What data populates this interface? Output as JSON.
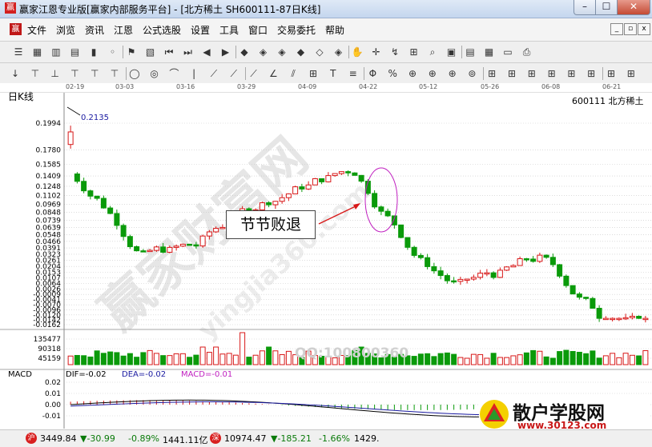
{
  "window": {
    "title": "赢家江恩专业版[赢家内部服务平台] - [北方稀土  SH600111-87日K线]",
    "logo_text": "赢",
    "min": "–",
    "max": "☐",
    "close": "✕"
  },
  "menu": {
    "logo_text": "赢",
    "items": [
      "文件",
      "浏览",
      "资讯",
      "江恩",
      "公式选股",
      "设置",
      "工具",
      "窗口",
      "交易委托",
      "帮助"
    ],
    "mdi_min": "_",
    "mdi_restore": "▫",
    "mdi_close": "x"
  },
  "toolbar1": {
    "icons": [
      "list-icon",
      "grid-icon",
      "bars-icon",
      "bar-chart-icon",
      "candle-icon",
      "cursor-icon",
      "flag-icon",
      "indicator-icon",
      "first-icon",
      "prev-icon",
      "back-icon",
      "forward-icon",
      "diamond-up-icon",
      "diamond-left-icon",
      "diamond-right-icon",
      "diamond-down-icon",
      "diamond-cross-icon",
      "diamond-all-icon",
      "hand-icon",
      "crosshair-icon",
      "zigzag-icon",
      "gift-icon",
      "search-icon",
      "calendar-icon",
      "card-icon",
      "save-icon",
      "car-icon",
      "printer-icon"
    ]
  },
  "toolbar2": {
    "icons": [
      "down-arrow-icon",
      "candle-tool-icon",
      "bars-tool-icon",
      "tick-tool-icon",
      "tick2-tool-icon",
      "tick3-tool-icon",
      "ellipse-tool-icon",
      "circle-tool-icon",
      "arc-tool-icon",
      "vline-tool-icon",
      "fan-tool-icon",
      "fan2-tool-icon",
      "speedline-tool-icon",
      "angle-tool-icon",
      "channel-tool-icon",
      "gann-tool-icon",
      "text-tool-icon",
      "lines-tool-icon",
      "fib-tool-icon",
      "percent-tool-icon",
      "gann-box-icon",
      "gann-box2-icon",
      "gann-box3-icon",
      "cycle-tool-icon",
      "gann-sq-icon",
      "gann-sq2-icon",
      "gann-sq3-icon",
      "gann-sq4-icon",
      "gann-sq5-icon",
      "gann-sq6-icon",
      "gann-sq7-icon",
      "gann-sq8-icon"
    ]
  },
  "chart": {
    "period_label": "日K线",
    "stock_label": "600111 北方稀土",
    "dates": [
      "02-19",
      "03-03",
      "03-16",
      "03-29",
      "04-09",
      "04-22",
      "05-12",
      "05-26",
      "06-08",
      "06-21"
    ],
    "high_mark": "0.2135",
    "callout": "节节败退",
    "watermark_qq": "QQ:100800360",
    "watermark_diag": "赢家财富网",
    "watermark_url": "yingjia360.com"
  },
  "chart_data": {
    "type": "candlestick",
    "price_ticks": [
      "0.1994",
      "0.1780",
      "0.1585",
      "0.1409",
      "0.1248",
      "0.1102",
      "0.0969",
      "0.0848",
      "0.0739",
      "0.0639",
      "0.0548",
      "0.0466",
      "0.0391",
      "0.0323",
      "0.0261",
      "0.0204",
      "0.0153",
      "0.0107",
      "0.0064",
      "0.0026",
      "-0.0009",
      "-0.0041",
      "-0.0070",
      "-0.0096",
      "-0.0120",
      "-0.0142",
      "-0.0162"
    ],
    "volume_ticks": [
      "135477",
      "90318",
      "45159"
    ],
    "macd_ticks": [
      "0.02",
      "0.01",
      "0.00",
      "-0.01"
    ],
    "macd_labels": {
      "name": "MACD",
      "dif": "DIF=-0.02",
      "dea": "DEA=-0.02",
      "macd": "MACD=-0.01"
    },
    "colors": {
      "up": "#d81818",
      "down": "#0a9a0a",
      "dif": "#000000",
      "dea": "#1a1aa0",
      "macd": "#c020c0"
    }
  },
  "status": {
    "sh_icon": "沪",
    "sh_index": "3449.84",
    "sh_change": "▼-30.99",
    "sh_pct": "-0.89%",
    "sh_amount": "1441.11亿",
    "sz_icon": "深",
    "sz_index": "10974.47",
    "sz_change": "▼-185.21",
    "sz_pct": "-1.66%",
    "sz_amount": "1429."
  },
  "watermark_logo": {
    "title": "散户学股网",
    "url": "www.30123.com"
  }
}
